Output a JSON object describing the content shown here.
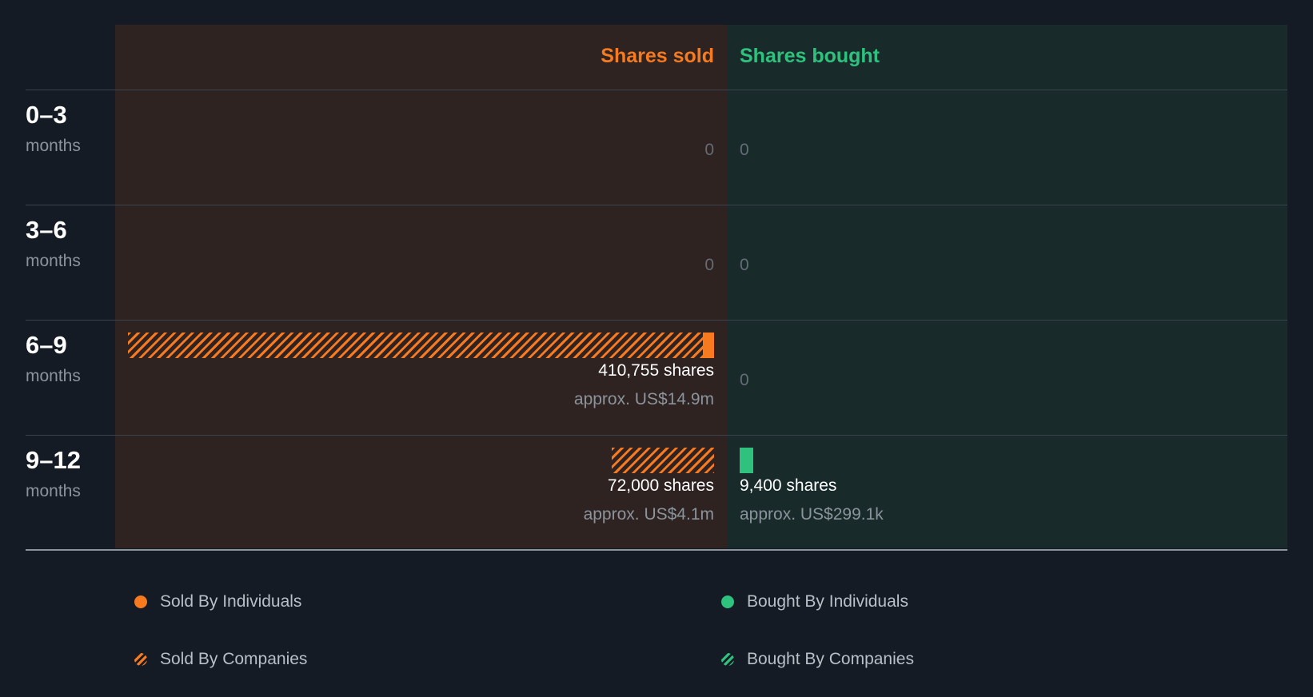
{
  "colors": {
    "sold": "#f77a1f",
    "bought": "#2ec27e",
    "background": "#151b24"
  },
  "chart_data": {
    "type": "bar",
    "layout": "diverging-horizontal",
    "column_headers": {
      "sold": "Shares sold",
      "bought": "Shares bought"
    },
    "categories": [
      {
        "range": "0–3",
        "unit": "months"
      },
      {
        "range": "3–6",
        "unit": "months"
      },
      {
        "range": "6–9",
        "unit": "months"
      },
      {
        "range": "9–12",
        "unit": "months"
      }
    ],
    "series": [
      {
        "name": "Sold By Individuals",
        "side": "sold",
        "style": "solid",
        "values": [
          0,
          0,
          8000,
          0
        ]
      },
      {
        "name": "Sold By Companies",
        "side": "sold",
        "style": "hatched",
        "values": [
          0,
          0,
          402755,
          72000
        ]
      },
      {
        "name": "Bought By Individuals",
        "side": "bought",
        "style": "solid",
        "values": [
          0,
          0,
          0,
          9400
        ]
      },
      {
        "name": "Bought By Companies",
        "side": "bought",
        "style": "hatched",
        "values": [
          0,
          0,
          0,
          0
        ]
      }
    ],
    "sold_totals": [
      {
        "shares": "0",
        "approx": ""
      },
      {
        "shares": "0",
        "approx": ""
      },
      {
        "shares": "410,755 shares",
        "approx": "approx. US$14.9m"
      },
      {
        "shares": "72,000 shares",
        "approx": "approx. US$4.1m"
      }
    ],
    "bought_totals": [
      {
        "shares": "0",
        "approx": ""
      },
      {
        "shares": "0",
        "approx": ""
      },
      {
        "shares": "0",
        "approx": ""
      },
      {
        "shares": "9,400 shares",
        "approx": "approx. US$299.1k"
      }
    ],
    "legend": [
      {
        "label": "Sold By Individuals",
        "icon": "solid-dot-orange"
      },
      {
        "label": "Bought By Individuals",
        "icon": "solid-dot-green"
      },
      {
        "label": "Sold By Companies",
        "icon": "hatched-dot-orange"
      },
      {
        "label": "Bought By Companies",
        "icon": "hatched-dot-green"
      }
    ],
    "legend_placement": "bottom"
  }
}
